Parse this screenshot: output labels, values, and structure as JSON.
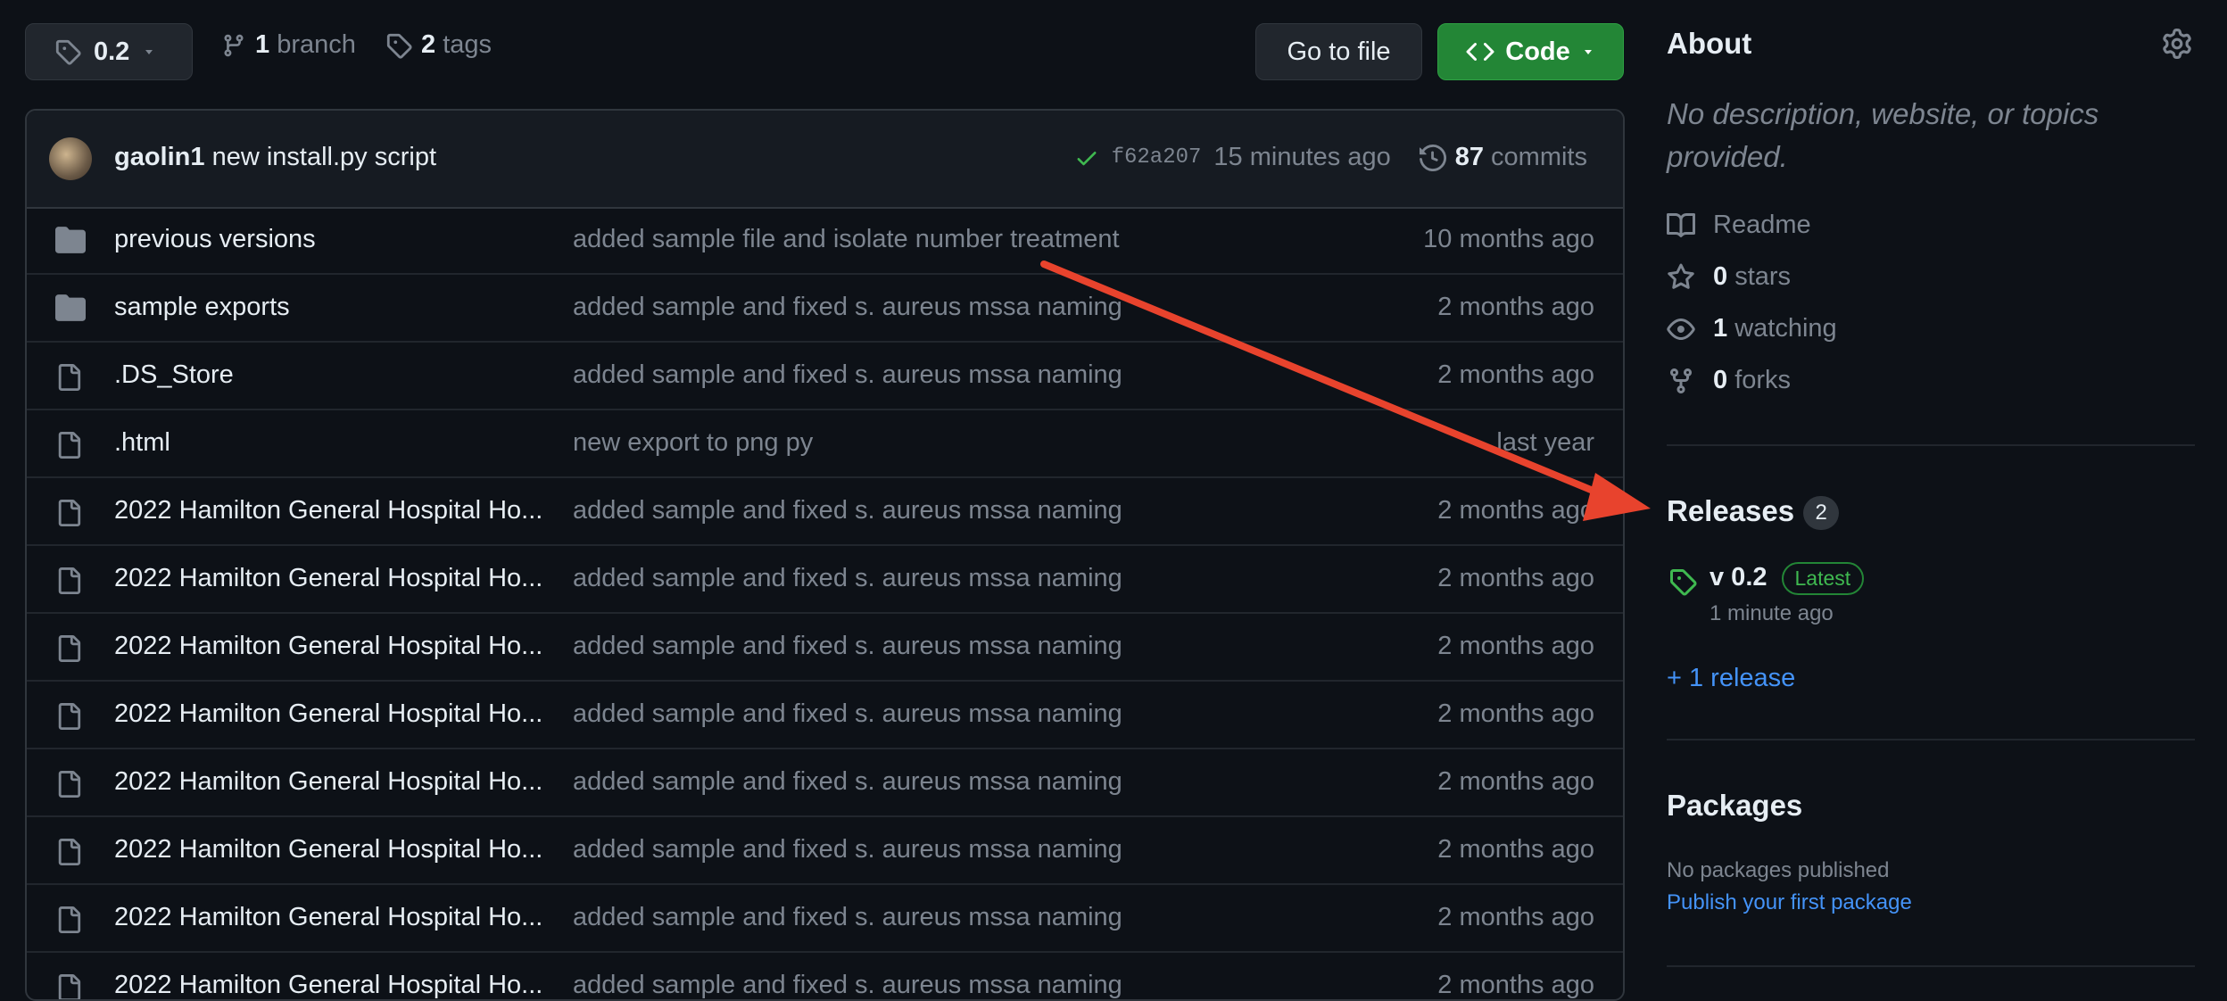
{
  "top_bar": {
    "branch_selector": "0.2",
    "branches_count": "1",
    "branches_label": "branch",
    "tags_count": "2",
    "tags_label": "tags",
    "go_to_file": "Go to file",
    "code_button": "Code"
  },
  "commit": {
    "author": "gaolin1",
    "message": "new install.py script",
    "sha": "f62a207",
    "time": "15 minutes ago",
    "commits_count": "87",
    "commits_label": "commits"
  },
  "files": [
    {
      "type": "folder",
      "name": "previous versions",
      "message": "added sample file and isolate number treatment",
      "time": "10 months ago"
    },
    {
      "type": "folder",
      "name": "sample exports",
      "message": "added sample and fixed s. aureus mssa naming",
      "time": "2 months ago"
    },
    {
      "type": "file",
      "name": ".DS_Store",
      "message": "added sample and fixed s. aureus mssa naming",
      "time": "2 months ago"
    },
    {
      "type": "file",
      "name": ".html",
      "message": "new export to png py",
      "time": "last year"
    },
    {
      "type": "file",
      "name": "2022 Hamilton General Hospital Ho...",
      "message": "added sample and fixed s. aureus mssa naming",
      "time": "2 months ago"
    },
    {
      "type": "file",
      "name": "2022 Hamilton General Hospital Ho...",
      "message": "added sample and fixed s. aureus mssa naming",
      "time": "2 months ago"
    },
    {
      "type": "file",
      "name": "2022 Hamilton General Hospital Ho...",
      "message": "added sample and fixed s. aureus mssa naming",
      "time": "2 months ago"
    },
    {
      "type": "file",
      "name": "2022 Hamilton General Hospital Ho...",
      "message": "added sample and fixed s. aureus mssa naming",
      "time": "2 months ago"
    },
    {
      "type": "file",
      "name": "2022 Hamilton General Hospital Ho...",
      "message": "added sample and fixed s. aureus mssa naming",
      "time": "2 months ago"
    },
    {
      "type": "file",
      "name": "2022 Hamilton General Hospital Ho...",
      "message": "added sample and fixed s. aureus mssa naming",
      "time": "2 months ago"
    },
    {
      "type": "file",
      "name": "2022 Hamilton General Hospital Ho...",
      "message": "added sample and fixed s. aureus mssa naming",
      "time": "2 months ago"
    },
    {
      "type": "file",
      "name": "2022 Hamilton General Hospital Ho...",
      "message": "added sample and fixed s. aureus mssa naming",
      "time": "2 months ago"
    }
  ],
  "about": {
    "title": "About",
    "description": "No description, website, or topics provided.",
    "readme": "Readme",
    "stars_count": "0",
    "stars_label": "stars",
    "watching_count": "1",
    "watching_label": "watching",
    "forks_count": "0",
    "forks_label": "forks"
  },
  "releases": {
    "title": "Releases",
    "count": "2",
    "latest_name": "v 0.2",
    "latest_badge": "Latest",
    "latest_time": "1 minute ago",
    "more_link": "+ 1 release"
  },
  "packages": {
    "title": "Packages",
    "empty_text": "No packages published",
    "publish_link": "Publish your first package"
  },
  "colors": {
    "background": "#0d1117",
    "code_button": "#238636",
    "link": "#4493f8",
    "annotation_arrow": "#e8432d"
  }
}
